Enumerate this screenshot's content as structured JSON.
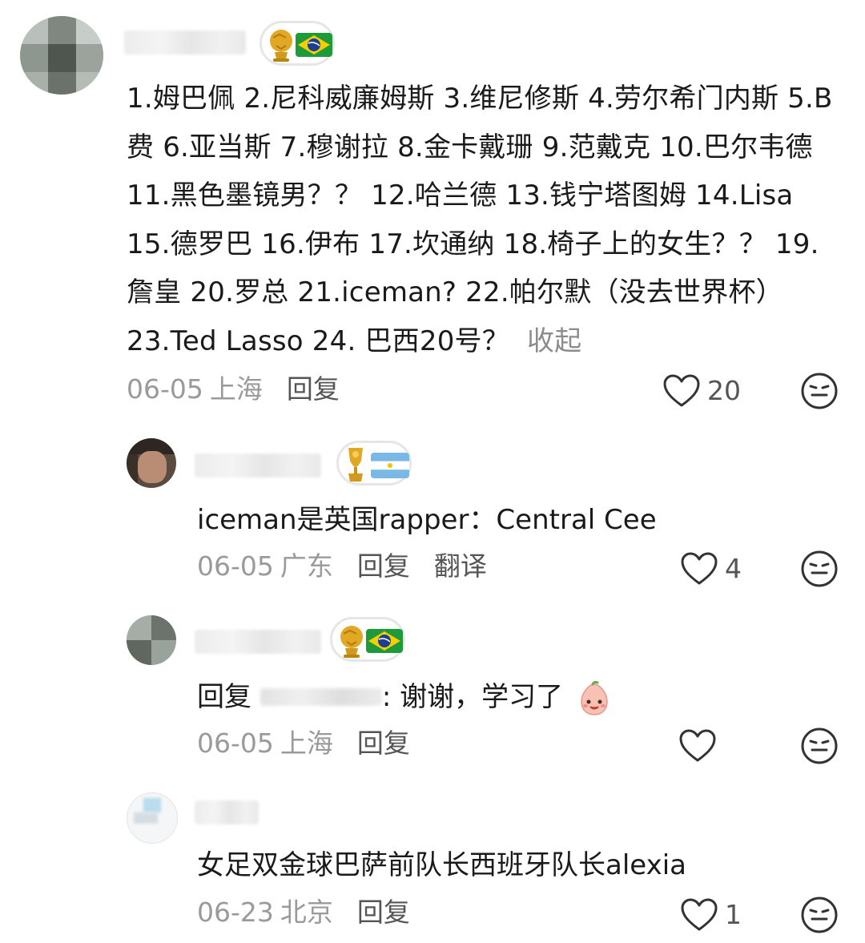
{
  "comments": [
    {
      "badge": {
        "trophy": "gold-ball-trophy",
        "flag": "brazil-flag"
      },
      "text": "1.姆巴佩 2.尼科威廉姆斯 3.维尼修斯 4.劳尔希门内斯 5.B费 6.亚当斯 7.穆谢拉 8.金卡戴珊 9.范戴克 10.巴尔韦德 11.黑色墨镜男？？ 12.哈兰德 13.钱宁塔图姆 14.Lisa 15.德罗巴 16.伊布 17.坎通纳 18.椅子上的女生？？ 19.詹皇 20.罗总 21.iceman? 22.帕尔默（没去世界杯）23.Ted Lasso 24. 巴西20号？",
      "collapse": "收起",
      "date": "06-05",
      "location": "上海",
      "reply": "回复",
      "likes": "20"
    },
    {
      "badge": {
        "trophy": "gold-cup-trophy",
        "flag": "argentina-flag"
      },
      "text": "iceman是英国rapper：Central Cee",
      "date": "06-05",
      "location": "广东",
      "reply": "回复",
      "translate": "翻译",
      "likes": "4"
    },
    {
      "badge": {
        "trophy": "gold-ball-trophy",
        "flag": "brazil-flag"
      },
      "reply_prefix": "回复",
      "text": ": 谢谢，学习了",
      "emoji": "smiling-peach-face-emoji",
      "date": "06-05",
      "location": "上海",
      "reply": "回复",
      "likes": ""
    },
    {
      "text": "女足双金球巴萨前队长西班牙队长alexia",
      "date": "06-23",
      "location": "北京",
      "reply": "回复",
      "likes": "1"
    }
  ],
  "colors": {
    "text": "#1a1a1a",
    "meta": "#9a9a9a",
    "action": "#555555",
    "gold": "#d9a21b",
    "brazil_green": "#1f9a3a",
    "brazil_yellow": "#f5d000",
    "brazil_blue": "#1e3f8f",
    "argentina_blue": "#7ab8e6"
  }
}
